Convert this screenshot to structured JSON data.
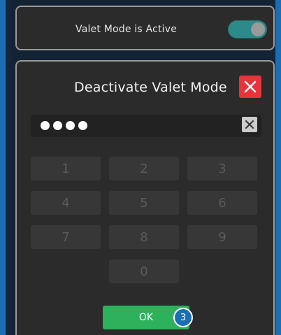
{
  "top_card": {
    "label": "Valet Mode is Active",
    "toggle_on": true
  },
  "dialog": {
    "title": "Deactivate Valet Mode",
    "pin_masked_count": 4,
    "keypad": [
      "1",
      "2",
      "3",
      "4",
      "5",
      "6",
      "7",
      "8",
      "9",
      "0"
    ],
    "ok_label": "OK",
    "step_badge": "3"
  },
  "colors": {
    "frame_border": "#1a6fb4",
    "toggle_on": "#2c8a8a",
    "close_red": "#e8333a",
    "ok_green": "#2db15a",
    "badge_blue": "#1a6fb4"
  },
  "icons": {
    "close": "close-icon",
    "clear": "clear-icon"
  }
}
